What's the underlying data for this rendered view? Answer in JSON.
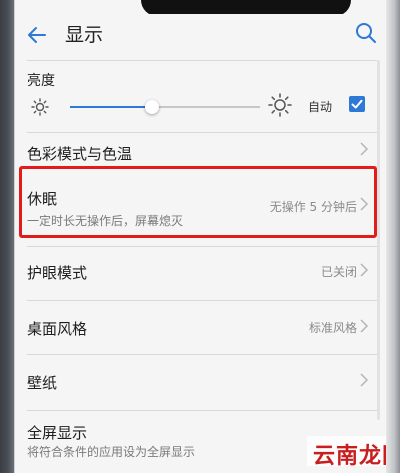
{
  "appbar": {
    "title": "显示"
  },
  "brightness": {
    "label": "亮度",
    "level": 0.43,
    "auto_label": "自动",
    "auto_checked": true
  },
  "rows": {
    "color_mode": {
      "title": "色彩模式与色温"
    },
    "sleep": {
      "title": "休眠",
      "subtitle": "一定时长无操作后，屏幕熄灭",
      "value": "无操作 5 分钟后"
    },
    "eye_comfort": {
      "title": "护眼模式",
      "value": "已关闭"
    },
    "home_style": {
      "title": "桌面风格",
      "value": "标准风格"
    },
    "wallpaper": {
      "title": "壁纸"
    },
    "full_screen": {
      "title": "全屏显示",
      "subtitle": "将符合条件的应用设为全屏显示"
    }
  },
  "watermark": {
    "text": "云南龙网"
  },
  "colors": {
    "accent": "#2e78d6",
    "highlight": "#e21b1b",
    "watermark": "#c91e1e"
  },
  "icons": [
    "back-arrow-icon",
    "search-icon",
    "sun-small-icon",
    "sun-large-icon",
    "checkbox-checked-icon",
    "chevron-right-icon"
  ]
}
